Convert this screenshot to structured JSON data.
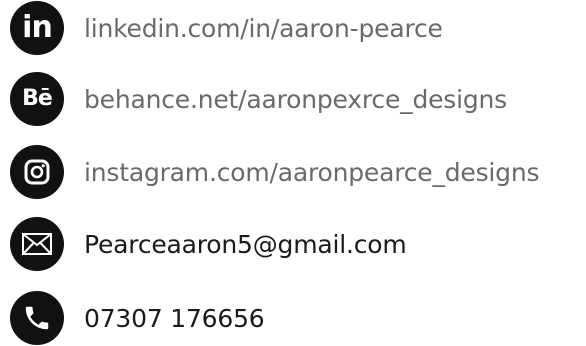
{
  "contacts": [
    {
      "icon": "linkedin-icon",
      "text": "linkedin.com/in/aaron-pearce"
    },
    {
      "icon": "behance-icon",
      "text": "behance.net/aaronpexrce_designs"
    },
    {
      "icon": "instagram-icon",
      "text": "instagram.com/aaronpearce_designs"
    },
    {
      "icon": "mail-icon",
      "text": "Pearceaaron5@gmail.com"
    },
    {
      "icon": "phone-icon",
      "text": "07307 176656"
    }
  ],
  "colors": {
    "icon_background": "#111111",
    "link_text": "#6a6a6a",
    "primary_text": "#1a1a1a"
  }
}
